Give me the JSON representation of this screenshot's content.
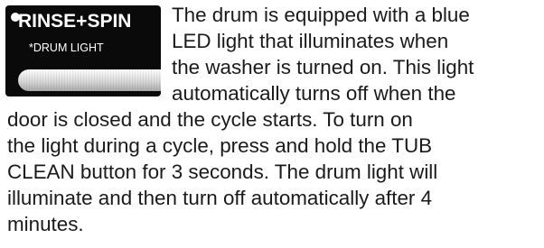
{
  "button": {
    "label_main": "RINSE+SPIN",
    "label_sub": "*DRUM LIGHT"
  },
  "paragraph": {
    "lines": [
      "The drum is equipped with a blue",
      "LED light that illuminates when",
      "the washer is turned on. This light",
      "automatically turns off when the",
      "door is closed and the cycle starts. To turn on",
      "the light during a cycle, press and hold the TUB",
      "CLEAN button for 3 seconds. The drum light will",
      "illuminate and then turn off automatically after 4",
      "minutes."
    ]
  }
}
